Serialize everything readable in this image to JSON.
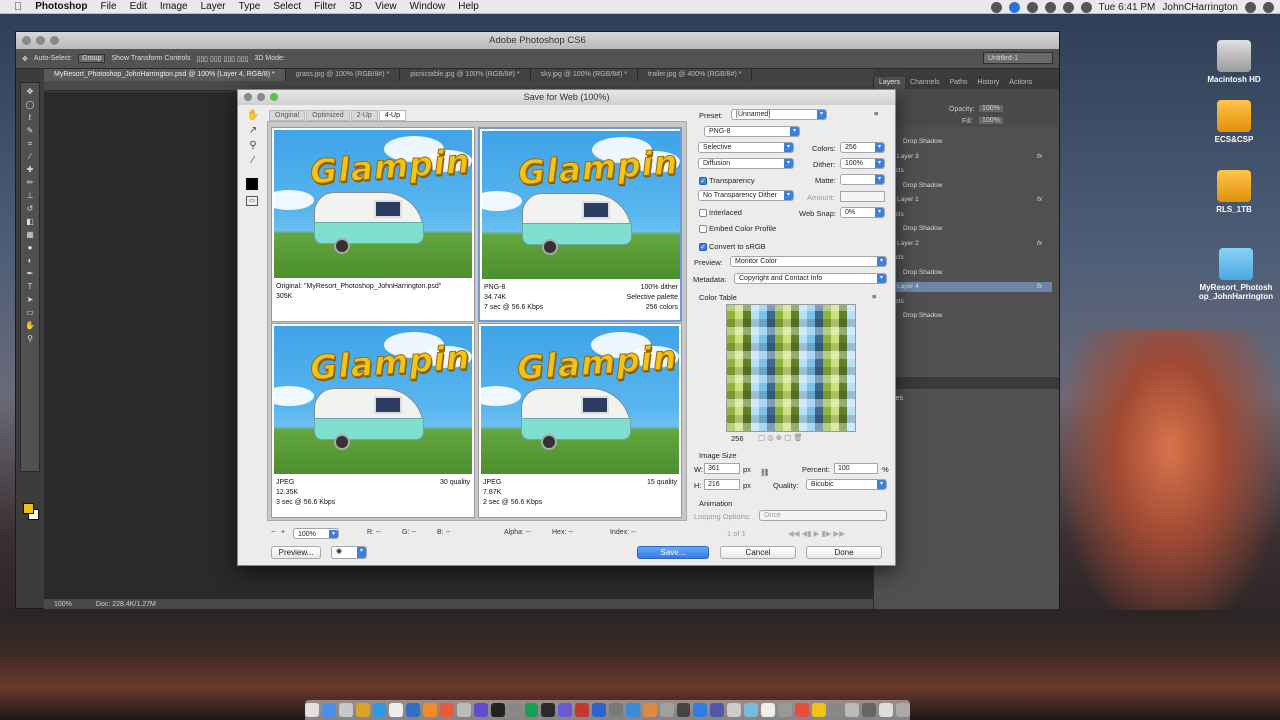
{
  "menubar": {
    "apple": "",
    "app": "Photoshop",
    "items": [
      "File",
      "Edit",
      "Image",
      "Layer",
      "Type",
      "Select",
      "Filter",
      "3D",
      "View",
      "Window",
      "Help"
    ],
    "clock": "Tue 6:41 PM",
    "user": "JohnCHarrington"
  },
  "ps": {
    "title": "Adobe Photoshop CS6",
    "options": {
      "auto_select": "Auto-Select:",
      "group": "Group",
      "show_transform": "Show Transform Controls",
      "mode3d": "3D Mode:",
      "workspace": "Untitled-1"
    },
    "tabs": [
      "MyResort_Photoshop_JohnHarrington.psd @ 100% (Layer 4, RGB/8) *",
      "grass.jpg @ 100% (RGB/8#) *",
      "picnictable.jpg @ 100% (RGB/8#) *",
      "sky.jpg @ 100% (RGB/8#) *",
      "trailer.jpg @ 400% (RGB/8#) *"
    ],
    "status": {
      "zoom": "100%",
      "doc": "Doc: 228.4K/1.27M"
    }
  },
  "panels": {
    "tabs": [
      "Layers",
      "Channels",
      "Paths",
      "History",
      "Actions"
    ],
    "opacity_label": "Opacity:",
    "opacity": "100%",
    "fill_label": "Fill:",
    "fill": "100%",
    "rows": [
      {
        "name": "Drop Shadow",
        "kind": "sub2"
      },
      {
        "name": "Layer 3",
        "kind": "layer",
        "fx": "fx"
      },
      {
        "name": "Effects",
        "kind": "sub"
      },
      {
        "name": "Drop Shadow",
        "kind": "sub2"
      },
      {
        "name": "Layer 1",
        "kind": "layer",
        "fx": "fx"
      },
      {
        "name": "Effects",
        "kind": "sub"
      },
      {
        "name": "Drop Shadow",
        "kind": "sub2"
      },
      {
        "name": "Layer 2",
        "kind": "layer",
        "fx": "fx"
      },
      {
        "name": "Effects",
        "kind": "sub"
      },
      {
        "name": "Drop Shadow",
        "kind": "sub2"
      },
      {
        "name": "Layer 4",
        "kind": "layer",
        "fx": "fx",
        "selected": true
      },
      {
        "name": "Effects",
        "kind": "sub"
      },
      {
        "name": "Drop Shadow",
        "kind": "sub2"
      }
    ],
    "props_tab": "rties",
    "props_label": "perties"
  },
  "desktop": [
    {
      "label": "Macintosh HD",
      "color": "#c8c8c8"
    },
    {
      "label": "ECS&CSP",
      "color": "#f4a61c"
    },
    {
      "label": "RLS_1TB",
      "color": "#f4a61c"
    },
    {
      "label": "MyResort_Photosh op_JohnHarrington",
      "color": "#5fb8ea"
    }
  ],
  "sfw": {
    "title": "Save for Web (100%)",
    "view_tabs": [
      "Original",
      "Optimized",
      "2-Up",
      "4-Up"
    ],
    "image_word": "Glamping",
    "previews": [
      {
        "l1": "Original: \"MyResort_Photoshop_JohnHarrington.psd\"",
        "l2": "305K",
        "l3": "",
        "r1": "",
        "r2": "",
        "r3": ""
      },
      {
        "l1": "PNG-8",
        "l2": "34.74K",
        "l3": "7 sec @ 56.6 Kbps",
        "r1": "100% dither",
        "r2": "Selective palette",
        "r3": "256 colors"
      },
      {
        "l1": "JPEG",
        "l2": "12.35K",
        "l3": "3 sec @ 56.6 Kbps",
        "r1": "30 quality",
        "r2": "",
        "r3": ""
      },
      {
        "l1": "JPEG",
        "l2": "7.87K",
        "l3": "2 sec @ 56.6 Kbps",
        "r1": "15 quality",
        "r2": "",
        "r3": ""
      }
    ],
    "preset_label": "Preset:",
    "preset": "[Unnamed]",
    "format": "PNG-8",
    "reduction": "Selective",
    "colors_label": "Colors:",
    "colors": "256",
    "dither_algo": "Diffusion",
    "dither_label": "Dither:",
    "dither": "100%",
    "transparency": "Transparency",
    "matte_label": "Matte:",
    "trans_dither": "No Transparency Dither",
    "amount_label": "Amount:",
    "interlaced": "Interlaced",
    "websnap_label": "Web Snap:",
    "websnap": "0%",
    "embed_profile": "Embed Color Profile",
    "convert_srgb": "Convert to sRGB",
    "preview_label": "Preview:",
    "preview_value": "Monitor Color",
    "metadata_label": "Metadata:",
    "metadata_value": "Copyright and Contact Info",
    "color_table_label": "Color Table",
    "color_count": "256",
    "image_size_label": "Image Size",
    "w_label": "W:",
    "w": "361",
    "h_label": "H:",
    "h": "216",
    "px": "px",
    "percent_label": "Percent:",
    "percent": "100",
    "percent_unit": "%",
    "quality_label": "Quality:",
    "quality": "Bicubic",
    "animation_label": "Animation",
    "looping_label": "Looping Options:",
    "looping": "Once",
    "frame": "1 of 1",
    "zoom": "100%",
    "r": "R: --",
    "g": "G: --",
    "b": "B: --",
    "alpha": "Alpha: --",
    "hex": "Hex: --",
    "index": "Index: --",
    "preview_btn": "Preview...",
    "save_btn": "Save...",
    "cancel_btn": "Cancel",
    "done_btn": "Done"
  }
}
